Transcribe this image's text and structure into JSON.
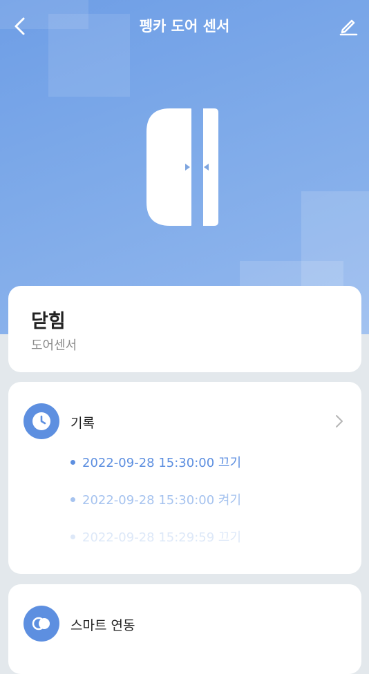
{
  "header": {
    "title": "펭카 도어 센서",
    "back_icon": "chevron-left-icon",
    "edit_icon": "pencil-icon"
  },
  "device": {
    "status": "닫힘",
    "type": "도어센서",
    "image": "door-sensor-icon"
  },
  "records": {
    "label": "기록",
    "icon": "clock-icon",
    "items": [
      {
        "time": "2022-09-28 15:30:00",
        "state": "끄기"
      },
      {
        "time": "2022-09-28 15:30:00",
        "state": "켜기"
      },
      {
        "time": "2022-09-28 15:29:59",
        "state": "끄기"
      }
    ]
  },
  "smart": {
    "label": "스마트 연동",
    "icon": "link-circles-icon"
  },
  "colors": {
    "accent": "#5d8fe0",
    "hero_top": "#6e9ee6",
    "hero_bottom": "#93b8ee",
    "background": "#e3e8ec"
  }
}
